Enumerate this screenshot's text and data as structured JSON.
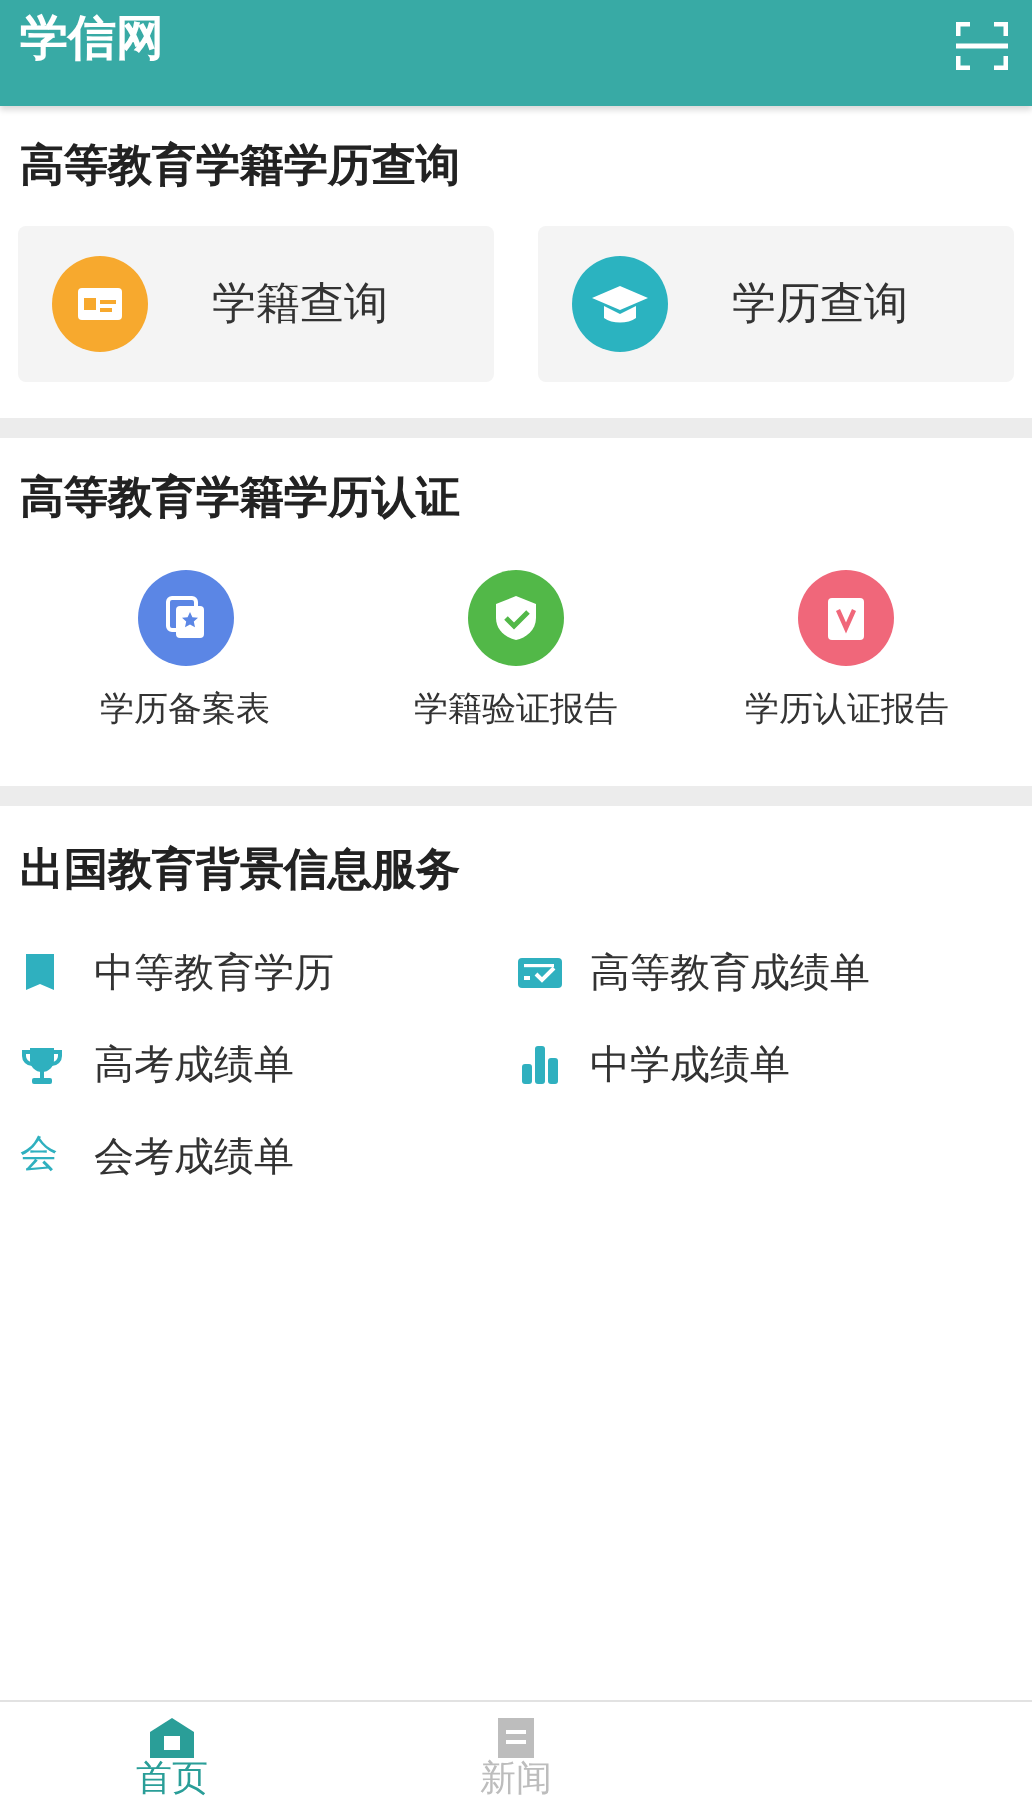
{
  "header": {
    "title": "学信网"
  },
  "query_section": {
    "title": "高等教育学籍学历查询",
    "cards": [
      {
        "kind": "id-card",
        "label": "学籍查询"
      },
      {
        "kind": "cap",
        "label": "学历查询"
      }
    ]
  },
  "cert_section": {
    "title": "高等教育学籍学历认证",
    "items": [
      {
        "kind": "record",
        "label": "学历备案表"
      },
      {
        "kind": "shield",
        "label": "学籍验证报告"
      },
      {
        "kind": "report",
        "label": "学历认证报告"
      }
    ]
  },
  "abroad_section": {
    "title": "出国教育背景信息服务",
    "items": [
      {
        "kind": "book",
        "label": "中等教育学历"
      },
      {
        "kind": "transcript",
        "label": "高等教育成绩单"
      },
      {
        "kind": "trophy",
        "label": "高考成绩单"
      },
      {
        "kind": "bars",
        "label": "中学成绩单"
      },
      {
        "kind": "glyph",
        "icon": "会",
        "label": "会考成绩单"
      }
    ]
  },
  "tab_bar": [
    {
      "kind": "home",
      "label": "首页",
      "selected": true
    },
    {
      "kind": "news",
      "label": "新闻",
      "selected": false
    }
  ]
}
